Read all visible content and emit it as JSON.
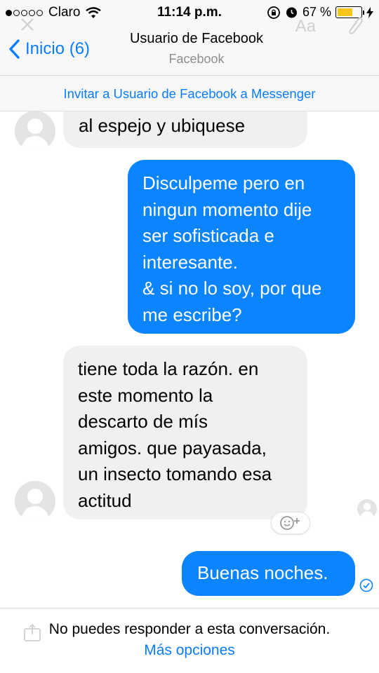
{
  "status_bar": {
    "carrier": "Claro",
    "signal_bars": 1,
    "signal_total": 5,
    "time": "11:14 p.m.",
    "battery_percent": "67 %",
    "battery_level": 0.67,
    "icons": [
      "wifi-icon",
      "rotation-lock-icon",
      "alarm-icon",
      "battery-icon",
      "charging-icon"
    ]
  },
  "nav": {
    "back_label": "Inicio (6)",
    "title": "Usuario de Facebook",
    "subtitle": "Facebook",
    "ghost_aa": "Aa"
  },
  "invite_banner": "Invitar a Usuario de Facebook a Messenger",
  "messages": [
    {
      "direction": "incoming",
      "text": "al espejo y ubiquese"
    },
    {
      "direction": "outgoing",
      "text": "Disculpeme pero en\nningun momento dije\nser sofisticada e\ninteresante.\n& si no lo soy, por que\nme escribe?"
    },
    {
      "direction": "incoming",
      "text": "tiene toda la razón. en\neste momento la\ndescarto de mís\namigos. que payasada,\nun insecto tomando esa\nactitud"
    },
    {
      "direction": "outgoing",
      "text": "Buenas noches."
    }
  ],
  "footer": {
    "text": "No puedes responder a esta conversación.",
    "link": "Más opciones"
  },
  "colors": {
    "accent": "#0a7cff",
    "outgoing_bubble": "#0a84ff",
    "incoming_bubble": "#f0f0f0",
    "battery": "#f5c518"
  }
}
